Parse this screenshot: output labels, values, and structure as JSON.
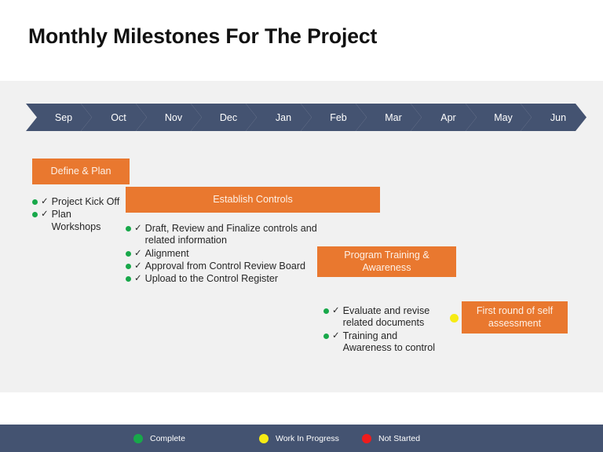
{
  "slide": {
    "title": "Monthly Milestones For The Project",
    "background_color": "#ffffff",
    "panel_color": "#f1f1f1",
    "accent_color": "#e9782f",
    "dark_color": "#445371"
  },
  "timeline": {
    "months": [
      {
        "label": "Sep"
      },
      {
        "label": "Oct"
      },
      {
        "label": "Nov"
      },
      {
        "label": "Dec"
      },
      {
        "label": "Jan"
      },
      {
        "label": "Feb"
      },
      {
        "label": "Mar"
      },
      {
        "label": "Apr"
      },
      {
        "label": "May"
      },
      {
        "label": "Jun"
      }
    ]
  },
  "phases": [
    {
      "label": "Define & Plan",
      "items": [
        {
          "text": "Project Kick Off",
          "status": "Complete",
          "dot": "green",
          "check": "✓"
        },
        {
          "text": "Plan Workshops",
          "status": "Complete",
          "dot": "green",
          "check": "✓"
        }
      ]
    },
    {
      "label": "Establish Controls",
      "items": [
        {
          "text": "Draft, Review and Finalize controls and related information",
          "status": "Complete",
          "dot": "green",
          "check": "✓"
        },
        {
          "text": "Alignment",
          "status": "Complete",
          "dot": "green",
          "check": "✓"
        },
        {
          "text": "Approval from  Control Review Board",
          "status": "Complete",
          "dot": "green",
          "check": "✓"
        },
        {
          "text": "Upload to the Control Register",
          "status": "Complete",
          "dot": "green",
          "check": "✓"
        }
      ]
    },
    {
      "label": "Program  Training & Awareness",
      "items": [
        {
          "text": "Evaluate and revise related documents",
          "status": "Complete",
          "dot": "green",
          "check": "✓"
        },
        {
          "text": "Training and Awareness to control",
          "status": "Complete",
          "dot": "green",
          "check": "✓"
        }
      ]
    },
    {
      "label": "First round of self assessment",
      "marker": {
        "status": "Work In Progress",
        "dot": "yellow"
      },
      "items": []
    }
  ],
  "legend": {
    "items": [
      {
        "label": "Complete",
        "dot": "green",
        "color": "#18a84a"
      },
      {
        "label": "Work In Progress",
        "dot": "yellow",
        "color": "#f6eb14"
      },
      {
        "label": "Not Started",
        "dot": "red",
        "color": "#ee1c1c"
      }
    ]
  }
}
